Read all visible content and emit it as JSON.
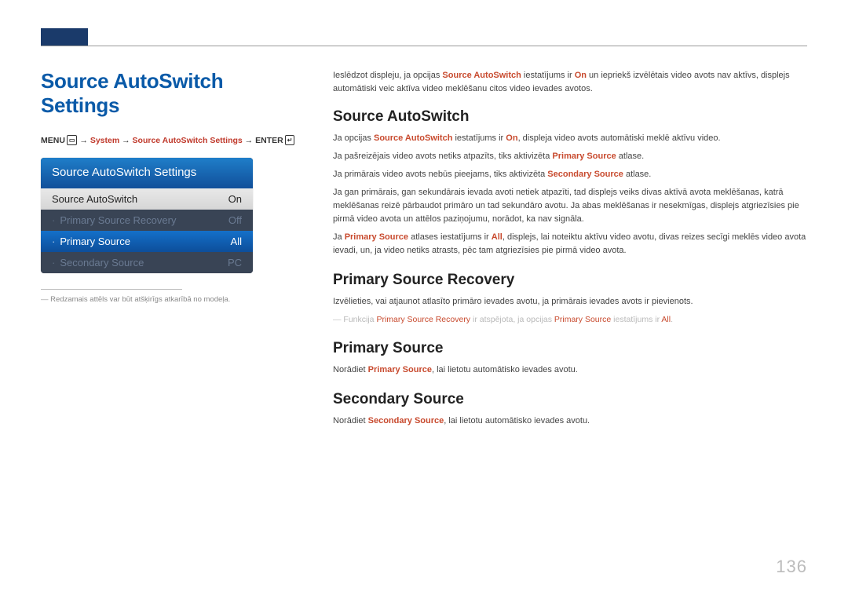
{
  "topSection": {
    "title": "Source AutoSwitch Settings"
  },
  "breadcrumb": {
    "menu": "MENU",
    "menuIcon": "▭",
    "sep": " → ",
    "system": "System",
    "settings": "Source AutoSwitch Settings",
    "enter": "ENTER",
    "enterIcon": "↵"
  },
  "osd": {
    "title": "Source AutoSwitch Settings",
    "rows": [
      {
        "label": "Source AutoSwitch",
        "value": "On",
        "style": "plain"
      },
      {
        "label": "Primary Source Recovery",
        "value": "Off",
        "style": "dim",
        "dot": true
      },
      {
        "label": "Primary Source",
        "value": "All",
        "style": "highlight",
        "dot": true
      },
      {
        "label": "Secondary Source",
        "value": "PC",
        "style": "dim",
        "dot": true
      }
    ]
  },
  "footnote": "Redzamais attēls var būt atšķirīgs atkarībā no modeļa.",
  "intro": {
    "seg1": "Ieslēdzot displeju, ja opcijas ",
    "term1": "Source AutoSwitch",
    "seg2": " iestatījums ir ",
    "term2": "On",
    "seg3": " un iepriekš izvēlētais video avots nav aktīvs, displejs automātiski veic aktīva video meklēšanu citos video ievades avotos."
  },
  "sections": {
    "s1": {
      "heading": "Source AutoSwitch",
      "p1": {
        "a": "Ja opcijas ",
        "b": "Source AutoSwitch",
        "c": " iestatījums ir ",
        "d": "On",
        "e": ", displeja video avots automātiski meklē aktīvu video."
      },
      "p2": {
        "a": "Ja pašreizējais video avots netiks atpazīts, tiks aktivizēta ",
        "b": "Primary Source",
        "c": " atlase."
      },
      "p3": {
        "a": "Ja primārais video avots nebūs pieejams, tiks aktivizēta ",
        "b": "Secondary Source",
        "c": " atlase."
      },
      "p4": "Ja gan primārais, gan sekundārais ievada avoti netiek atpazīti, tad displejs veiks divas aktīvā avota meklēšanas, katrā meklēšanas reizē pārbaudot primāro un tad sekundāro avotu. Ja abas meklēšanas ir nesekmīgas, displejs atgriezīsies pie pirmā video avota un attēlos paziņojumu, norādot, ka nav signāla.",
      "p5": {
        "a": "Ja ",
        "b": "Primary Source",
        "c": " atlases iestatījums ir ",
        "d": "All",
        "e": ", displejs, lai noteiktu aktīvu video avotu, divas reizes secīgi meklēs video avota ievadi, un, ja video netiks atrasts, pēc tam atgriezīsies pie pirmā video avota."
      }
    },
    "s2": {
      "heading": "Primary Source Recovery",
      "p1": "Izvēlieties, vai atjaunot atlasīto primāro ievades avotu, ja primārais ievades avots ir pievienots.",
      "note": {
        "a": "Funkcija ",
        "b": "Primary Source Recovery",
        "c": " ir atspējota, ja opcijas ",
        "d": "Primary Source",
        "e": " iestatījums ir ",
        "f": "All",
        "g": "."
      }
    },
    "s3": {
      "heading": "Primary Source",
      "p1": {
        "a": "Norādiet ",
        "b": "Primary Source",
        "c": ", lai lietotu automātisko ievades avotu."
      }
    },
    "s4": {
      "heading": "Secondary Source",
      "p1": {
        "a": "Norādiet ",
        "b": "Secondary Source",
        "c": ", lai lietotu automātisko ievades avotu."
      }
    }
  },
  "pageNumber": "136"
}
